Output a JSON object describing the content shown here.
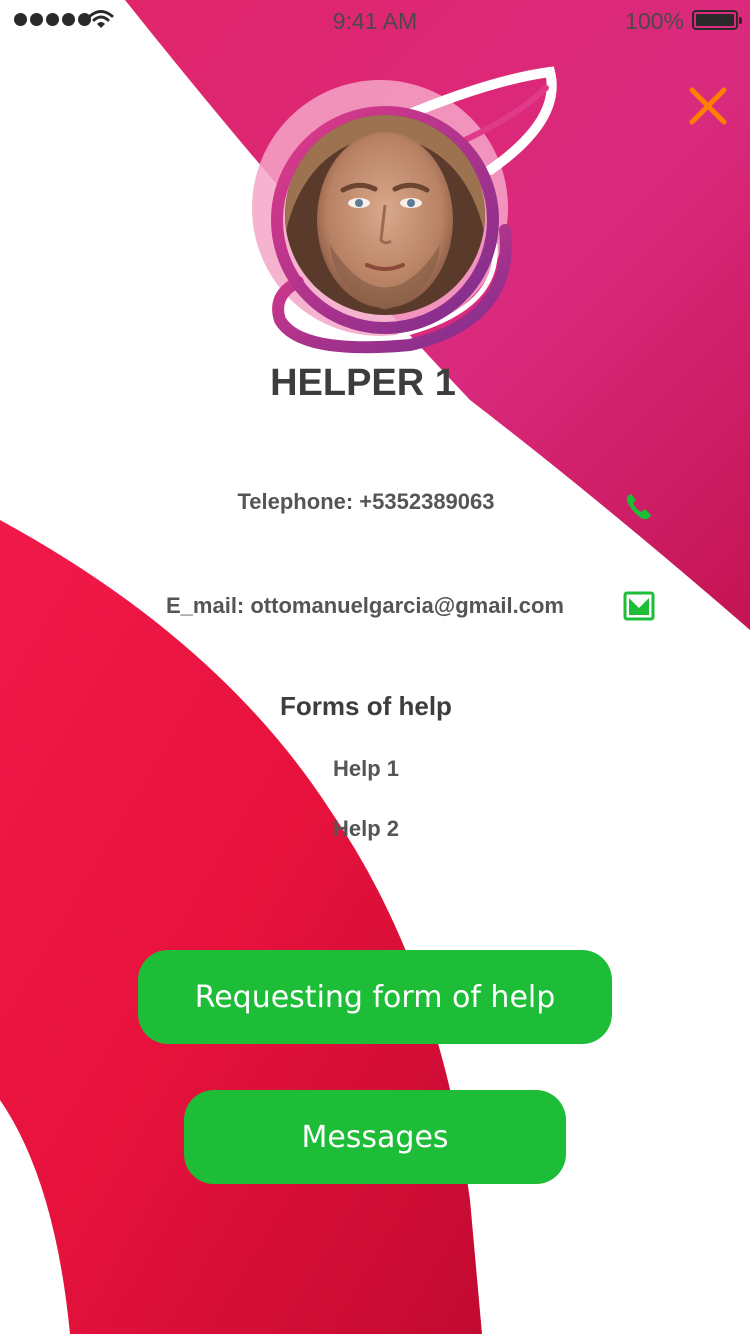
{
  "status_bar": {
    "time": "9:41 AM",
    "battery": "100%",
    "signal_icon": "signal-dots-icon",
    "wifi_icon": "wifi-icon",
    "battery_icon": "battery-icon"
  },
  "header": {
    "close_icon": "close-icon",
    "close_color": "#ff7f00"
  },
  "profile": {
    "title": "HELPER 1",
    "avatar": "avatar-photo"
  },
  "contact": {
    "telephone": "Telephone: +5352389063",
    "email": "E_mail: ottomanuelgarcia@gmail.com",
    "phone_icon": "phone-icon",
    "mail_icon": "mail-icon",
    "icon_color": "#1dbd38"
  },
  "forms_of_help": {
    "title": "Forms of help",
    "items": [
      "Help 1",
      "Help 2"
    ]
  },
  "actions": {
    "request_label": "Requesting form of help",
    "messages_label": "Messages",
    "button_color": "#1dbd38"
  },
  "colors": {
    "accent_magenta": "#d81b60",
    "accent_red": "#f2163c",
    "avatar_ring": "#7b2d8e"
  }
}
